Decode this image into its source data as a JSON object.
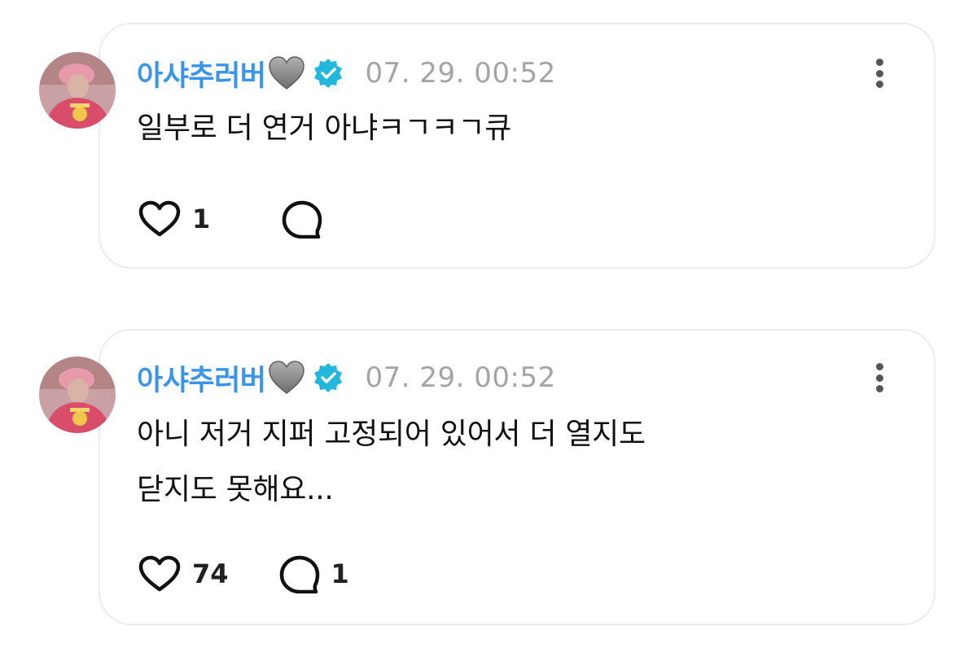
{
  "posts": [
    {
      "username": "아샤추러버",
      "timestamp": "07. 29. 00:52",
      "text_lines": [
        "일부로 더 연거 아냐ㅋㄱㅋㄱ큐"
      ],
      "like_count": "1",
      "reply_count": ""
    },
    {
      "username": "아샤추러버",
      "timestamp": "07. 29. 00:52",
      "text_lines": [
        "아니 저거 지퍼 고정되어 있어서 더 열지도",
        "닫지도 못해요..."
      ],
      "like_count": "74",
      "reply_count": "1"
    }
  ],
  "icons": {
    "username_heart": "grey-heart-icon",
    "verified": "verified-badge-icon",
    "more": "more-vertical-icon",
    "like": "heart-outline-icon",
    "reply": "comment-bubble-icon"
  },
  "colors": {
    "username": "#3a95ea",
    "verified": "#22b8dd",
    "timestamp": "#a4a4a4",
    "card_border": "#ececec"
  }
}
